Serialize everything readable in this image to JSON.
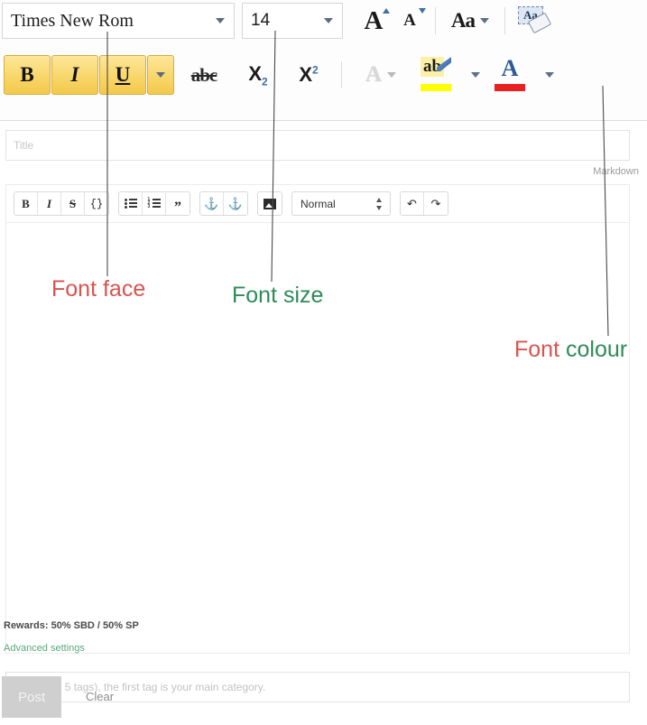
{
  "ribbon": {
    "font_name": "Times New Rom",
    "font_size": "14",
    "grow_font": "A",
    "shrink_font": "A",
    "change_case": "Aa",
    "clear_formatting": "Aa",
    "bold": "B",
    "italic": "I",
    "underline": "U",
    "strikethrough": "abc",
    "subscript": "X",
    "subscript_index": "2",
    "superscript": "X",
    "superscript_index": "2",
    "text_effects": "A",
    "highlight": "ab",
    "font_color": "A"
  },
  "editor": {
    "title_placeholder": "Title",
    "markdown_label": "Markdown",
    "body_text": "",
    "toolbar": {
      "bold": "B",
      "italic": "I",
      "strikethrough": "S",
      "code": "{}",
      "bullet_list": "bullet-list-icon",
      "numbered_list": "numbered-list-icon",
      "quote": "”",
      "link": "⚓",
      "unlink": "⚓",
      "image": "image-icon",
      "style": "Normal",
      "undo": "↶",
      "redo": "↷"
    }
  },
  "footer": {
    "tag_placeholder": "Tag (up to 5 tags), the first tag is your main category.",
    "rewards": "Rewards: 50% SBD / 50% SP",
    "advanced_settings": "Advanced settings",
    "post_label": "Post",
    "clear_label": "Clear"
  },
  "annotations": {
    "font_face": "Font face",
    "font_size": "Font size",
    "font_colour_part1": "Font ",
    "font_colour_part2": "colour",
    "color_red": "#d9534f",
    "color_green": "#2e8b57"
  }
}
